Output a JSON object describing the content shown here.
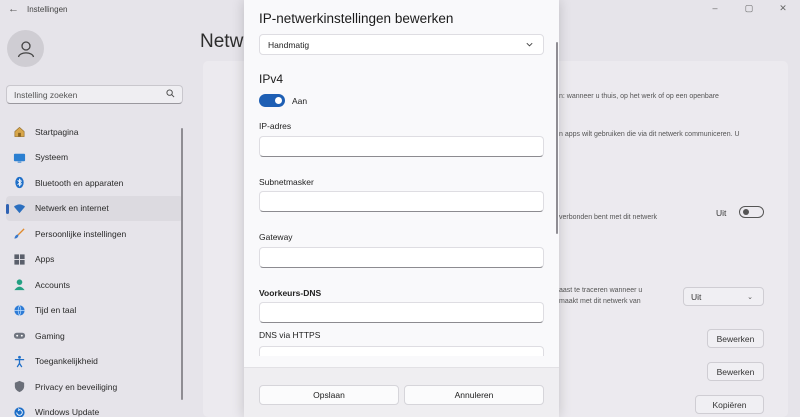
{
  "window": {
    "title": "Instellingen",
    "back_glyph": "←",
    "controls": [
      "–",
      "▢",
      "✕"
    ]
  },
  "sidebar": {
    "search_placeholder": "Instelling zoeken",
    "items": [
      {
        "label": "Startpagina",
        "icon": "home-icon"
      },
      {
        "label": "Systeem",
        "icon": "system-icon"
      },
      {
        "label": "Bluetooth en apparaten",
        "icon": "bluetooth-icon"
      },
      {
        "label": "Netwerk en internet",
        "icon": "wifi-icon",
        "active": true
      },
      {
        "label": "Persoonlijke instellingen",
        "icon": "brush-icon"
      },
      {
        "label": "Apps",
        "icon": "apps-icon"
      },
      {
        "label": "Accounts",
        "icon": "accounts-icon"
      },
      {
        "label": "Tijd en taal",
        "icon": "globe-icon"
      },
      {
        "label": "Gaming",
        "icon": "gamepad-icon"
      },
      {
        "label": "Toegankelijkheid",
        "icon": "accessibility-icon"
      },
      {
        "label": "Privacy en beveiliging",
        "icon": "shield-icon"
      },
      {
        "label": "Windows Update",
        "icon": "update-icon"
      }
    ]
  },
  "background": {
    "heading": "Netw",
    "text1": "n: wanneer u thuis, op het werk of op een openbare",
    "text2": "n apps wilt gebruiken die via dit netwerk communiceren. U",
    "text3": "verbonden bent met dit netwerk",
    "text4": "aast te traceren wanneer u",
    "text5": "maakt met dit netwerk van",
    "toggle_label": "Uit",
    "select_value": "Uit",
    "buttons": [
      "Bewerken",
      "Bewerken",
      "Kopiëren"
    ]
  },
  "dialog": {
    "title": "IP-netwerkinstellingen bewerken",
    "mode_value": "Handmatig",
    "section": "IPv4",
    "toggle_label": "Aan",
    "fields": {
      "ip": "IP-adres",
      "subnet": "Subnetmasker",
      "gateway": "Gateway",
      "dns": "Voorkeurs-DNS",
      "https": "DNS via HTTPS"
    },
    "save": "Opslaan",
    "cancel": "Annuleren"
  },
  "colors": {
    "accent": "#1e5fb4"
  }
}
